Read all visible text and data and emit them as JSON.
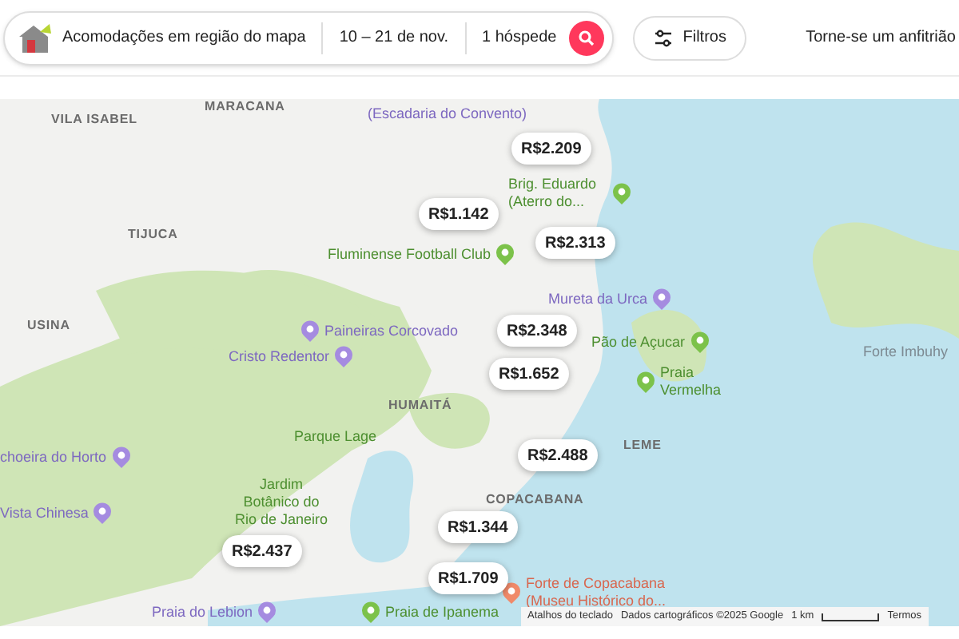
{
  "search": {
    "location": "Acomodações em região do mapa",
    "dates": "10 – 21 de nov.",
    "guests": "1 hóspede"
  },
  "filters": {
    "label": "Filtros"
  },
  "host_link": "Torne-se um anfitrião",
  "map": {
    "place_labels": [
      {
        "text": "MARACANA",
        "kind": "district"
      },
      {
        "text": "VILA ISABEL",
        "kind": "district"
      },
      {
        "text": "TIJUCA",
        "kind": "district"
      },
      {
        "text": "USINA",
        "kind": "district"
      },
      {
        "text": "(Escadaria do Convento)",
        "kind": "attraction"
      },
      {
        "text": "Fluminense Football Club",
        "kind": "park"
      },
      {
        "text": "Brig. Eduardo (Aterro do...",
        "kind": "park"
      },
      {
        "text": "Paineiras Corcovado",
        "kind": "attraction"
      },
      {
        "text": "Cristo Redentor",
        "kind": "attraction"
      },
      {
        "text": "Mureta da Urca",
        "kind": "attraction"
      },
      {
        "text": "Pão de Açucar",
        "kind": "park"
      },
      {
        "text": "Forte Imbuhy",
        "kind": "other"
      },
      {
        "text": "Praia Vermelha",
        "kind": "park"
      },
      {
        "text": "HUMAITÁ",
        "kind": "district"
      },
      {
        "text": "Parque Lage",
        "kind": "park"
      },
      {
        "text": "choeira do Horto",
        "kind": "attraction"
      },
      {
        "text": "Vista Chinesa",
        "kind": "attraction"
      },
      {
        "text": "Jardim Botânico do Rio de Janeiro",
        "kind": "park"
      },
      {
        "text": "LEME",
        "kind": "district"
      },
      {
        "text": "COPACABANA",
        "kind": "district"
      },
      {
        "text": "Praia do Lebion",
        "kind": "attraction"
      },
      {
        "text": "Praia de Ipanema",
        "kind": "park"
      },
      {
        "text": "Forte de Copacabana (Museu Histórico do...",
        "kind": "museum"
      }
    ],
    "price_pins": [
      {
        "label": "R$2.209"
      },
      {
        "label": "R$1.142"
      },
      {
        "label": "R$2.313"
      },
      {
        "label": "R$2.348"
      },
      {
        "label": "R$1.652"
      },
      {
        "label": "R$2.488"
      },
      {
        "label": "R$1.344"
      },
      {
        "label": "R$1.709"
      },
      {
        "label": "R$2.437"
      }
    ],
    "attribution": {
      "shortcuts": "Atalhos do teclado",
      "map_data": "Dados cartográficos ©2025 Google",
      "scale": "1 km",
      "terms": "Termos"
    }
  }
}
